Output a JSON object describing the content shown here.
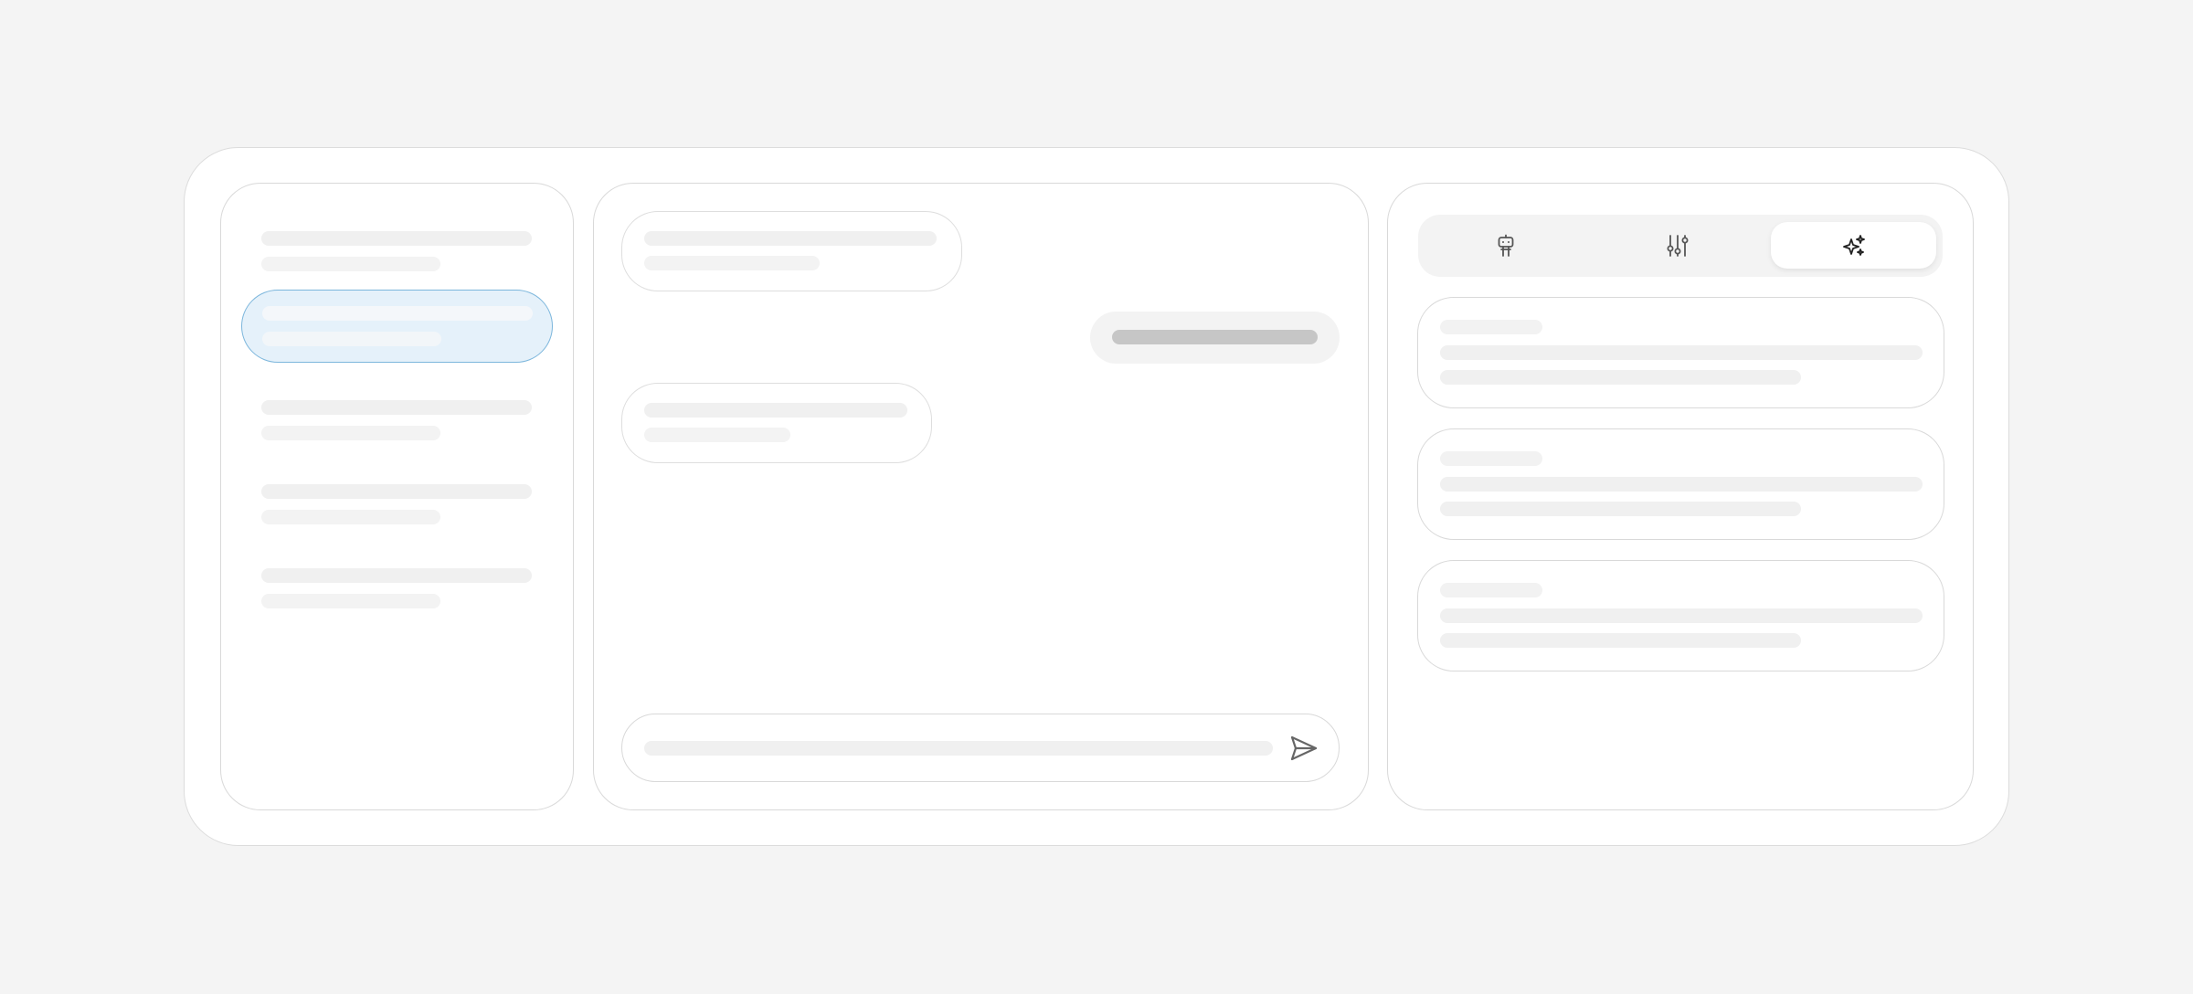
{
  "app": {
    "sessions": [
      {
        "selected": false
      },
      {
        "selected": true
      },
      {
        "selected": false
      },
      {
        "selected": false
      },
      {
        "selected": false
      }
    ]
  },
  "right_panel": {
    "tabs": [
      {
        "icon": "robot-icon",
        "active": false
      },
      {
        "icon": "sliders-icon",
        "active": false
      },
      {
        "icon": "sparkles-icon",
        "active": true
      }
    ]
  },
  "colors": {
    "background": "#f4f4f4",
    "selected_fill": "#e5f1fa",
    "selected_border": "#7cb6dc",
    "skeleton": "#f0f0f0",
    "user_bubble": "#f3f3f3"
  }
}
